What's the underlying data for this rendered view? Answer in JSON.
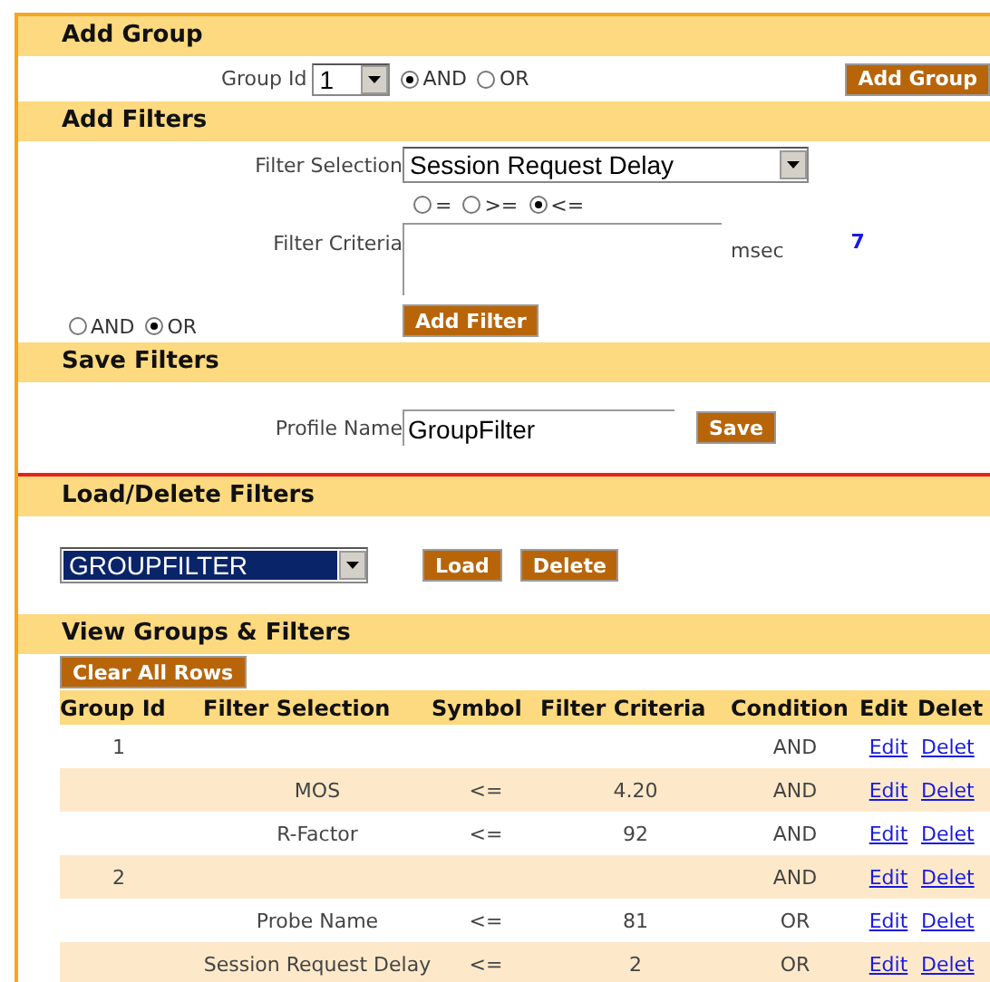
{
  "add_group": {
    "title": "Add Group",
    "group_id_label": "Group Id",
    "group_id_value": "1",
    "logic": [
      {
        "label": "AND",
        "selected": true
      },
      {
        "label": "OR",
        "selected": false
      }
    ],
    "button": "Add Group"
  },
  "add_filters": {
    "title": "Add Filters",
    "filter_selection_label": "Filter Selection",
    "filter_selection_value": "Session Request Delay",
    "operators": [
      {
        "label": "=",
        "selected": false
      },
      {
        "label": ">=",
        "selected": false
      },
      {
        "label": "<=",
        "selected": true
      }
    ],
    "filter_criteria_label": "Filter Criteria",
    "unit": "msec",
    "count": "7",
    "logic": [
      {
        "label": "AND",
        "selected": false
      },
      {
        "label": "OR",
        "selected": true
      }
    ],
    "button": "Add Filter"
  },
  "save_filters": {
    "title": "Save Filters",
    "profile_name_label": "Profile Name",
    "profile_name_value": "GroupFilter",
    "button": "Save"
  },
  "load_delete": {
    "title": "Load/Delete Filters",
    "profile_value": "GROUPFILTER",
    "buttons": [
      "Load",
      "Delete"
    ]
  },
  "view": {
    "title": "View Groups & Filters",
    "clear_button": "Clear All Rows",
    "table": {
      "columns": [
        "Group Id",
        "Filter Selection",
        "Symbol",
        "Filter Criteria",
        "Condition",
        "Edit",
        "Delet"
      ],
      "rows": [
        {
          "group_id": "1",
          "condition": "AND",
          "edit": "Edit",
          "delete": "Delet"
        },
        {
          "filter_selection": "MOS",
          "symbol": "<=",
          "criteria": "4.20",
          "condition": "AND",
          "edit": "Edit",
          "delete": "Delet"
        },
        {
          "filter_selection": "R-Factor",
          "symbol": "<=",
          "criteria": "92",
          "condition": "AND",
          "edit": "Edit",
          "delete": "Delet"
        },
        {
          "group_id": "2",
          "condition": "AND",
          "edit": "Edit",
          "delete": "Delet"
        },
        {
          "filter_selection": "Probe Name",
          "symbol": "<=",
          "criteria": "81",
          "condition": "OR",
          "edit": "Edit",
          "delete": "Delet"
        },
        {
          "filter_selection": "Session Request Delay",
          "symbol": "<=",
          "criteria": "2",
          "condition": "OR",
          "edit": "Edit",
          "delete": "Delet"
        }
      ]
    }
  }
}
